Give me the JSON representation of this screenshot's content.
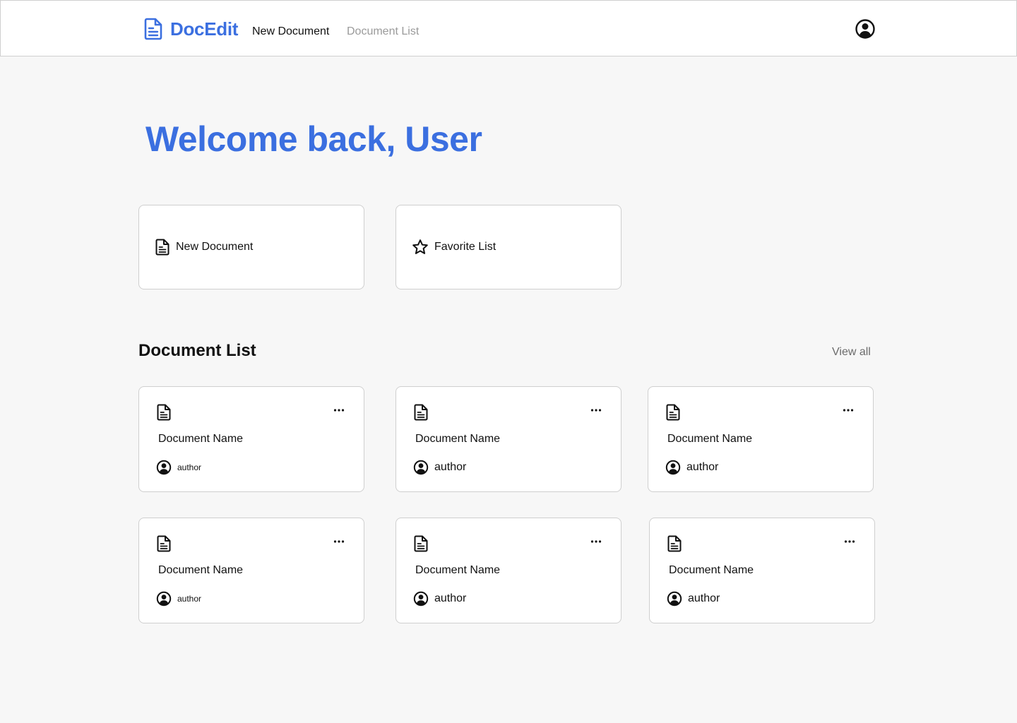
{
  "app": {
    "name": "DocEdit"
  },
  "nav": {
    "new_document": "New Document",
    "document_list": "Document List"
  },
  "welcome": {
    "title": "Welcome back, User"
  },
  "actions": [
    {
      "label": "New Document",
      "icon": "document-icon"
    },
    {
      "label": "Favorite List",
      "icon": "star-icon"
    }
  ],
  "document_list": {
    "title": "Document List",
    "view_all": "View all",
    "documents": [
      {
        "name": "Document Name",
        "author": "author"
      },
      {
        "name": "Document Name",
        "author": "author"
      },
      {
        "name": "Document Name",
        "author": "author"
      },
      {
        "name": "Document Name",
        "author": "author"
      },
      {
        "name": "Document Name",
        "author": "author"
      },
      {
        "name": "Document Name",
        "author": "author"
      }
    ]
  },
  "colors": {
    "brand": "#3b6fe0",
    "muted": "#9a9a9a",
    "border": "#cfcfcf",
    "background": "#f7f7f7"
  }
}
